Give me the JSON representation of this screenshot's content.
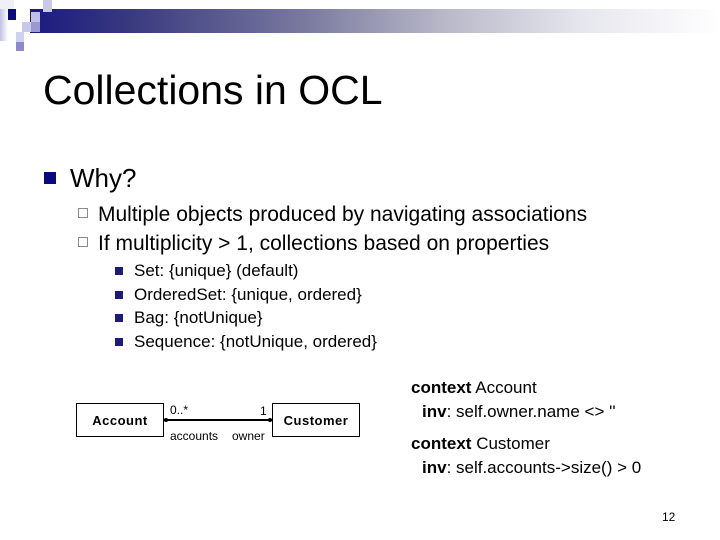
{
  "slide": {
    "title": "Collections in OCL",
    "page_number": "12",
    "accent_color": "#0a0a80",
    "bullets": [
      {
        "text": "Why?",
        "sub": [
          {
            "text": "Multiple objects produced by navigating associations"
          },
          {
            "text": "If multiplicity > 1, collections based on properties",
            "sub": [
              {
                "text": "Set: {unique} (default)"
              },
              {
                "text": "OrderedSet: {unique, ordered}"
              },
              {
                "text": "Bag: {notUnique}"
              },
              {
                "text": "Sequence: {notUnique, ordered}"
              }
            ]
          }
        ]
      }
    ]
  },
  "uml": {
    "left_class": "Account",
    "right_class": "Customer",
    "left_multiplicity": "0..*",
    "right_multiplicity": "1",
    "left_role": "accounts",
    "right_role": "owner"
  },
  "ocl": [
    {
      "keyword": "context",
      "context": " Account",
      "inv_keyword": "inv",
      "expression": ": self.owner.name <> ''"
    },
    {
      "keyword": "context",
      "context": " Customer",
      "inv_keyword": "inv",
      "expression": ": self.accounts->size() > 0"
    }
  ]
}
